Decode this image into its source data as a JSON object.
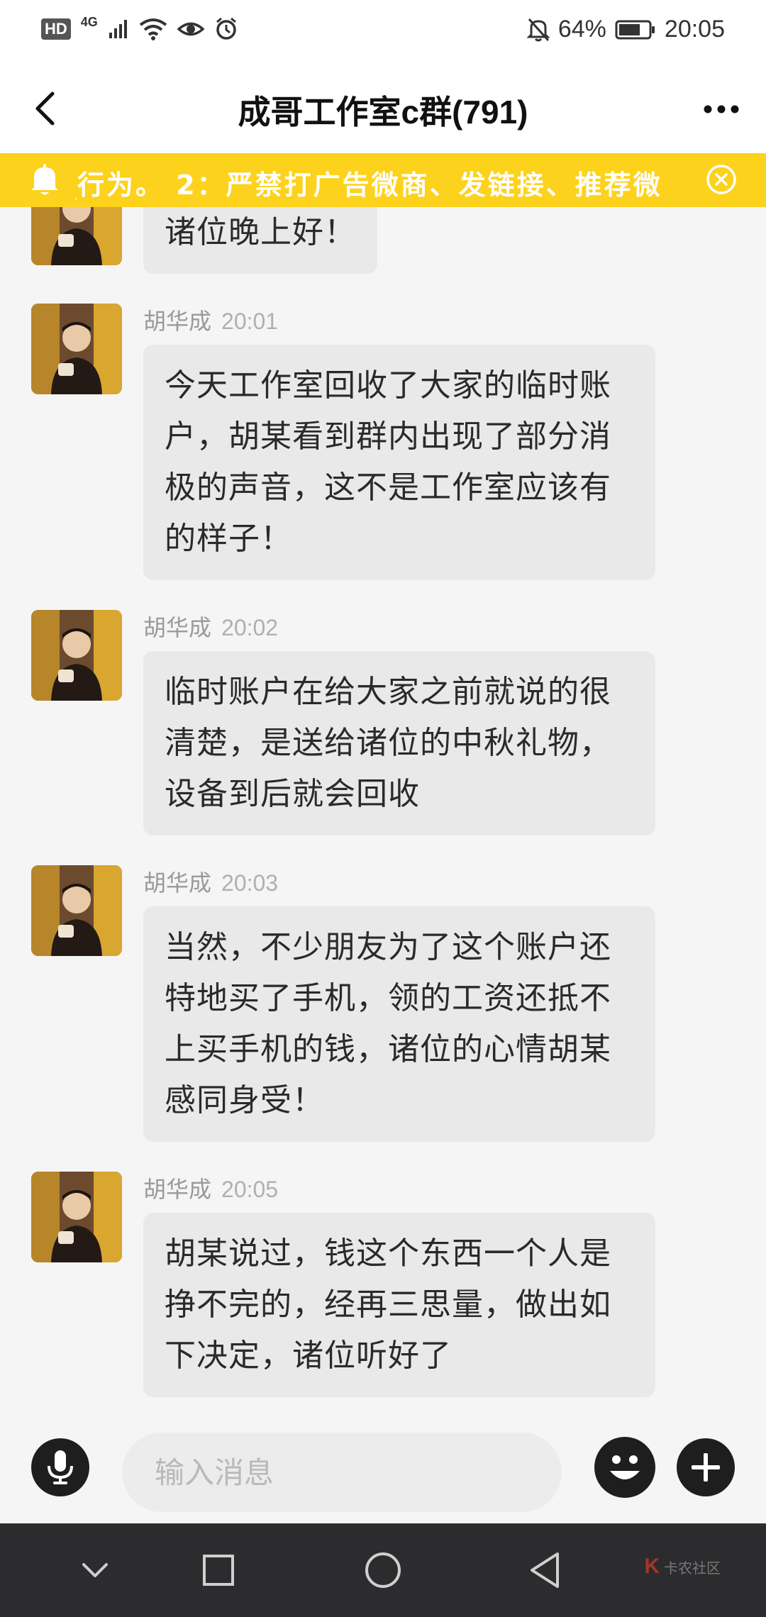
{
  "status_bar": {
    "hd": "HD",
    "network": "4G",
    "battery": "64%",
    "time": "20:05"
  },
  "header": {
    "title": "成哥工作室c群(791)"
  },
  "notice": {
    "text": "ׅ行为。 2：严禁打广告微商、发链接、推荐微"
  },
  "messages": [
    {
      "sender": "",
      "time": "",
      "text": "诸位晚上好！"
    },
    {
      "sender": "胡华成",
      "time": "20:01",
      "text": "今天工作室回收了大家的临时账户，胡某看到群内出现了部分消极的声音，这不是工作室应该有的样子！"
    },
    {
      "sender": "胡华成",
      "time": "20:02",
      "text": "临时账户在给大家之前就说的很清楚，是送给诸位的中秋礼物，设备到后就会回收"
    },
    {
      "sender": "胡华成",
      "time": "20:03",
      "text": "当然，不少朋友为了这个账户还特地买了手机，领的工资还抵不上买手机的钱，诸位的心情胡某感同身受！"
    },
    {
      "sender": "胡华成",
      "time": "20:05",
      "text": "胡某说过，钱这个东西一个人是挣不完的，经再三思量，做出如下决定，诸位听好了"
    }
  ],
  "input": {
    "placeholder": "输入消息"
  },
  "watermark": {
    "logo": "K",
    "text": "卡农社区"
  }
}
